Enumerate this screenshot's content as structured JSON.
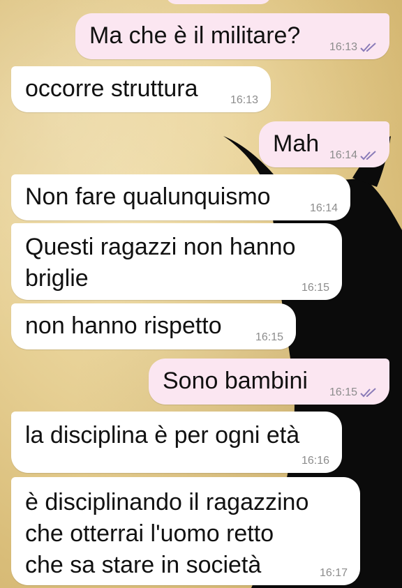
{
  "conversation": {
    "messages": [
      {
        "direction": "out",
        "text": "Ma che è il militare?",
        "time": "16:13",
        "read_receipt": "double-check-icon"
      },
      {
        "direction": "in",
        "text": "occorre struttura",
        "time": "16:13"
      },
      {
        "direction": "out",
        "text": "Mah",
        "time": "16:14",
        "read_receipt": "double-check-icon"
      },
      {
        "direction": "in",
        "text": "Non fare qualunquismo",
        "time": "16:14"
      },
      {
        "direction": "in",
        "text": "Questi ragazzi non hanno\nbriglie",
        "time": "16:15"
      },
      {
        "direction": "in",
        "text": "non hanno rispetto",
        "time": "16:15"
      },
      {
        "direction": "out",
        "text": "Sono bambini",
        "time": "16:15",
        "read_receipt": "double-check-icon"
      },
      {
        "direction": "in",
        "text": "la disciplina è per ogni età",
        "time": "16:16"
      },
      {
        "direction": "in",
        "text": "è disciplinando il ragazzino\nche otterrai l'uomo retto\nche sa stare in società",
        "time": "16:17"
      }
    ]
  },
  "colors": {
    "incoming_bubble": "#ffffff",
    "outgoing_bubble": "#fbe6f1",
    "timestamp": "#8c8c8c",
    "read_check": "#8a7bb8",
    "wallpaper": "#e6cf93",
    "silhouette": "#0b0b0b"
  }
}
